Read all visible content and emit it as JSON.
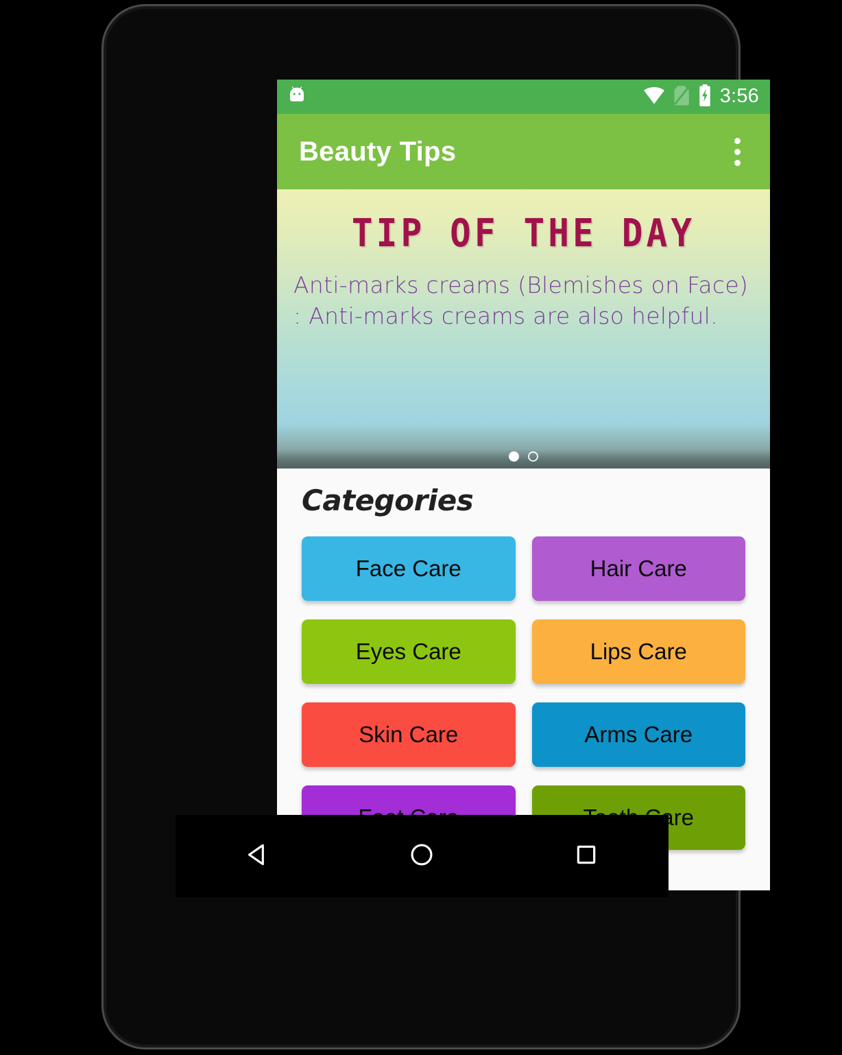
{
  "status_bar": {
    "notification_icon": "android-robot-icon",
    "icons": [
      "wifi-icon",
      "no-sim-icon",
      "battery-charging-icon"
    ],
    "time": "3:56",
    "background": "#4CAF50"
  },
  "app_bar": {
    "title": "Beauty Tips",
    "overflow_icon": "overflow-menu-icon",
    "background": "#7CC143"
  },
  "tip_card": {
    "title": "TIP OF THE DAY",
    "title_color": "#A1124B",
    "body": "Anti-marks creams (Blemishes on Face) : Anti-marks creams are also helpful.",
    "body_color": "#7B3F98",
    "pager": {
      "total": 2,
      "active_index": 0
    }
  },
  "categories": {
    "heading": "Categories",
    "items": [
      {
        "label": "Face Care",
        "color": "#38B6E4"
      },
      {
        "label": "Hair Care",
        "color": "#B05BD0"
      },
      {
        "label": "Eyes Care",
        "color": "#8CC610"
      },
      {
        "label": "Lips Care",
        "color": "#FBB03F"
      },
      {
        "label": "Skin Care",
        "color": "#FB4C42"
      },
      {
        "label": "Arms Care",
        "color": "#0D93C9"
      },
      {
        "label": "Feet Care",
        "color": "#A32DD6"
      },
      {
        "label": "Teeth Care",
        "color": "#6EA006"
      }
    ]
  },
  "nav_bar": {
    "buttons": [
      {
        "name": "back-button",
        "icon": "back-triangle-icon"
      },
      {
        "name": "home-button",
        "icon": "home-circle-icon"
      },
      {
        "name": "recents-button",
        "icon": "recents-square-icon"
      }
    ]
  }
}
